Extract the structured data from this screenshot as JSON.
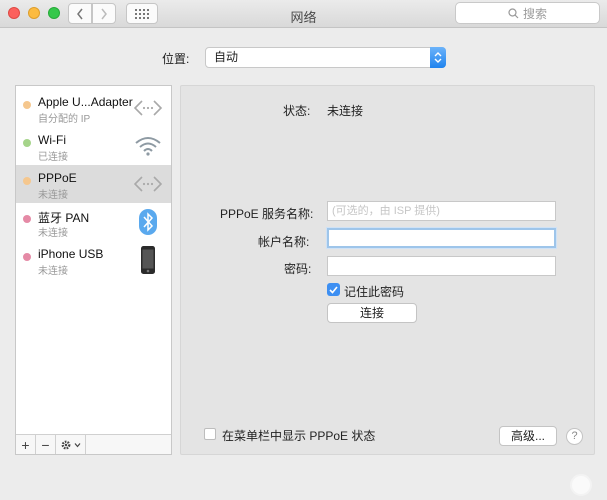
{
  "window": {
    "title": "网络",
    "search_placeholder": "搜索"
  },
  "location": {
    "label": "位置:",
    "value": "自动"
  },
  "services": [
    {
      "name": "Apple U...Adapter",
      "status": "自分配的 IP",
      "dot_color": "#f5c78e",
      "icon": "ethernet-icon"
    },
    {
      "name": "Wi-Fi",
      "status": "已连接",
      "dot_color": "#a5d48a",
      "icon": "wifi-icon"
    },
    {
      "name": "PPPoE",
      "status": "未连接",
      "dot_color": "#f5c78e",
      "icon": "ethernet-icon"
    },
    {
      "name": "蓝牙 PAN",
      "status": "未连接",
      "dot_color": "#e58aa6",
      "icon": "bluetooth-icon"
    },
    {
      "name": "iPhone USB",
      "status": "未连接",
      "dot_color": "#e58aa6",
      "icon": "iphone-icon"
    }
  ],
  "sidebar_toolbar": {
    "add": "+",
    "remove": "−"
  },
  "detail": {
    "status_label": "状态:",
    "status_value": "未连接",
    "service_name_label": "PPPoE 服务名称:",
    "service_name_placeholder": "(可选的，由 ISP 提供)",
    "account_label": "帐户名称:",
    "account_value": "",
    "password_label": "密码:",
    "password_value": "",
    "remember_label": "记住此密码",
    "remember_checked": true,
    "connect_button": "连接"
  },
  "footer": {
    "show_in_menubar_label": "在菜单栏中显示 PPPoE 状态",
    "show_in_menubar_checked": false,
    "advanced_button": "高级...",
    "help_button": "?"
  },
  "colors": {
    "accent": "#3d8ff2",
    "focus_ring": "#9ec5ea"
  }
}
